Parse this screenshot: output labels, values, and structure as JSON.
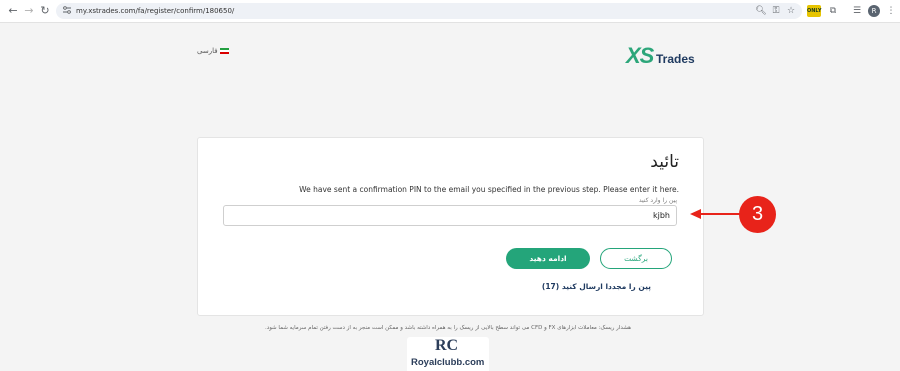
{
  "browser": {
    "url": "my.xstrades.com/fa/register/confirm/180650/",
    "profile_initial": "R",
    "extension_badge": "ONLY"
  },
  "page": {
    "language": "فارسی",
    "logo": {
      "xs": "XS",
      "trades": "Trades"
    },
    "card": {
      "title": "تائید",
      "message": "We have sent a confirmation PIN to the email you specified in the previous step. Please enter it here.",
      "pin_label": "پین را وارد کنید",
      "pin_value": "kjbh",
      "continue_label": "ادامه دهید",
      "back_label": "برگشت",
      "resend_label": "پین را مجددا ارسال کنید (17)"
    },
    "risk_warning": "هشدار ریسک: معاملات ابزارهای FX و CFD می تواند سطح بالایی از ریسک را به همراه داشته باشد و ممکن است منجر به از دست رفتن تمام سرمایه شما شود.",
    "annotation_number": "3",
    "watermark": {
      "mark": "RC",
      "text": "Royalclubb.com"
    }
  },
  "colors": {
    "accent": "#24a57a",
    "navy": "#1f3a60",
    "annotation": "#e8231a"
  }
}
